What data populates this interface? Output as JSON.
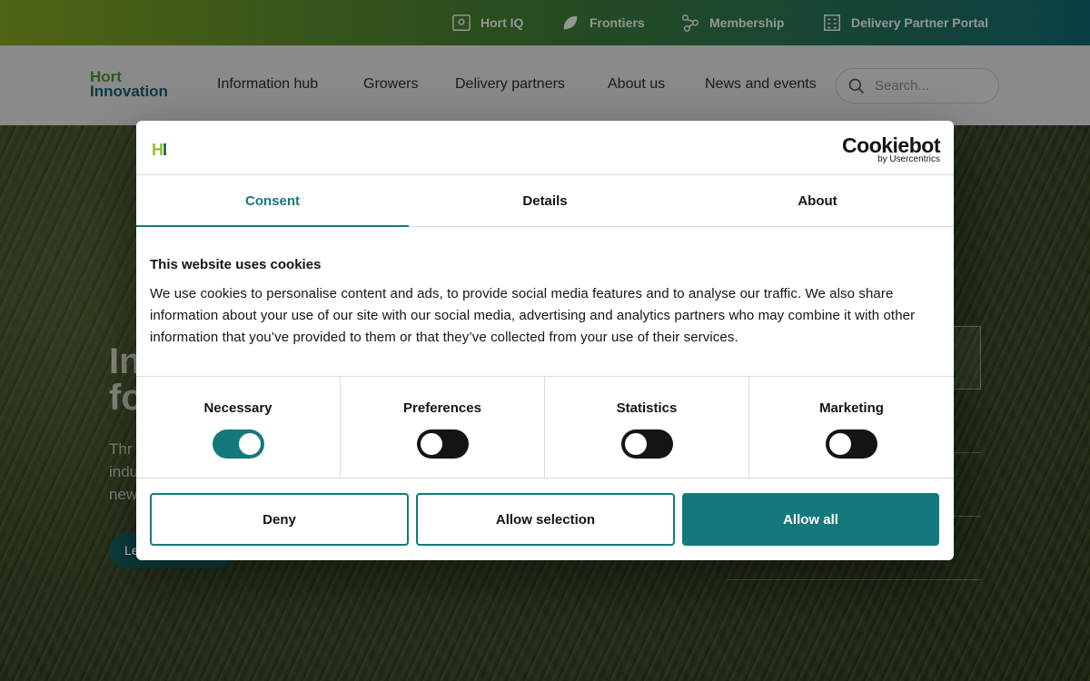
{
  "topbar": {
    "links": [
      {
        "label": "Hort IQ",
        "icon": "map-pin-icon"
      },
      {
        "label": "Frontiers",
        "icon": "leaf-icon"
      },
      {
        "label": "Membership",
        "icon": "network-icon"
      },
      {
        "label": "Delivery Partner Portal",
        "icon": "building-icon"
      }
    ]
  },
  "nav": {
    "logo_line1": "Hort",
    "logo_line2": "Innovation",
    "items": [
      "Information hub",
      "Growers",
      "Delivery partners",
      "About us",
      "News and events"
    ],
    "search_placeholder": "Search..."
  },
  "hero": {
    "title_line1": "In",
    "title_line2": "fo",
    "text_line1": "Thr",
    "text_line2": "indu",
    "text_line3": "new",
    "button_label": "Le"
  },
  "cookie": {
    "brand_mark_h": "H",
    "brand_mark_i": "I",
    "cookiebot_name": "Cookiebot",
    "cookiebot_sub": "by Usercentrics",
    "tabs": [
      "Consent",
      "Details",
      "About"
    ],
    "active_tab": "Consent",
    "title": "This website uses cookies",
    "body": "We use cookies to personalise content and ads, to provide social media features and to analyse our traffic. We also share information about your use of our site with our social media, advertising and analytics partners who may combine it with other information that you’ve provided to them or that they’ve collected from your use of their services.",
    "categories": [
      {
        "label": "Necessary",
        "enabled": true
      },
      {
        "label": "Preferences",
        "enabled": false
      },
      {
        "label": "Statistics",
        "enabled": false
      },
      {
        "label": "Marketing",
        "enabled": false
      }
    ],
    "buttons": {
      "deny": "Deny",
      "allow_selection": "Allow selection",
      "allow_all": "Allow all"
    }
  },
  "colors": {
    "accent": "#13797c",
    "logo_green": "#8dbf2e"
  }
}
